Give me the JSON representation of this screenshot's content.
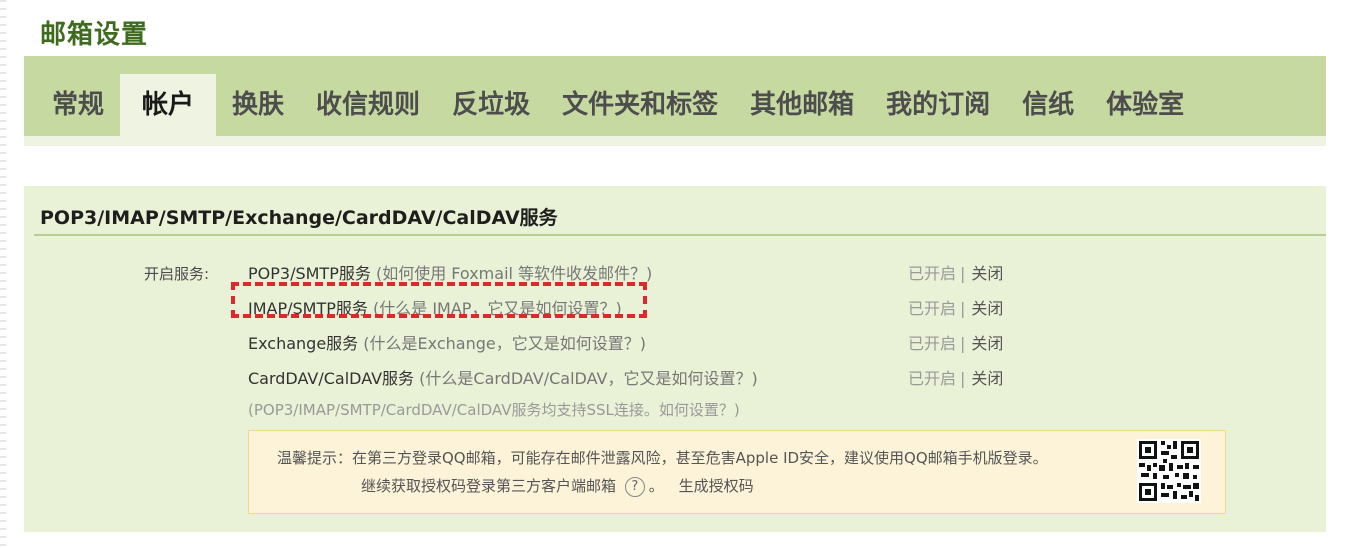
{
  "page": {
    "title": "邮箱设置"
  },
  "tabs": [
    {
      "label": "常规"
    },
    {
      "label": "帐户"
    },
    {
      "label": "换肤"
    },
    {
      "label": "收信规则"
    },
    {
      "label": "反垃圾"
    },
    {
      "label": "文件夹和标签"
    },
    {
      "label": "其他邮箱"
    },
    {
      "label": "我的订阅"
    },
    {
      "label": "信纸"
    },
    {
      "label": "体验室"
    }
  ],
  "active_tab": "帐户",
  "services": {
    "title": "POP3/IMAP/SMTP/Exchange/CardDAV/CalDAV服务",
    "label": "开启服务:",
    "rows": [
      {
        "name": "POP3/SMTP服务",
        "help": "(如何使用 Foxmail 等软件收发邮件？)",
        "status": "已开启",
        "action": "关闭"
      },
      {
        "name": "IMAP/SMTP服务",
        "help": "(什么是 IMAP，它又是如何设置？)",
        "status": "已开启",
        "action": "关闭"
      },
      {
        "name": "Exchange服务",
        "help": "(什么是Exchange，它又是如何设置？)",
        "status": "已开启",
        "action": "关闭"
      },
      {
        "name": "CardDAV/CalDAV服务",
        "help": "(什么是CardDAV/CalDAV，它又是如何设置？)",
        "status": "已开启",
        "action": "关闭"
      }
    ],
    "ssl_note": "(POP3/IMAP/SMTP/CardDAV/CalDAV服务均支持SSL连接。如何设置？)"
  },
  "warning": {
    "line1": "温馨提示：在第三方登录QQ邮箱，可能存在邮件泄露风险，甚至危害Apple ID安全，建议使用QQ邮箱手机版登录。",
    "line2": "继续获取授权码登录第三方客户端邮箱",
    "help_glyph": "?",
    "period": "。",
    "generate_link": "生成授权码"
  },
  "colors": {
    "tab_bar": "#c6d9a1",
    "panel": "#e9f2d6",
    "title_green": "#3f6b1e",
    "highlight_red": "#e3262b",
    "warning_bg": "#fdf3d9"
  }
}
